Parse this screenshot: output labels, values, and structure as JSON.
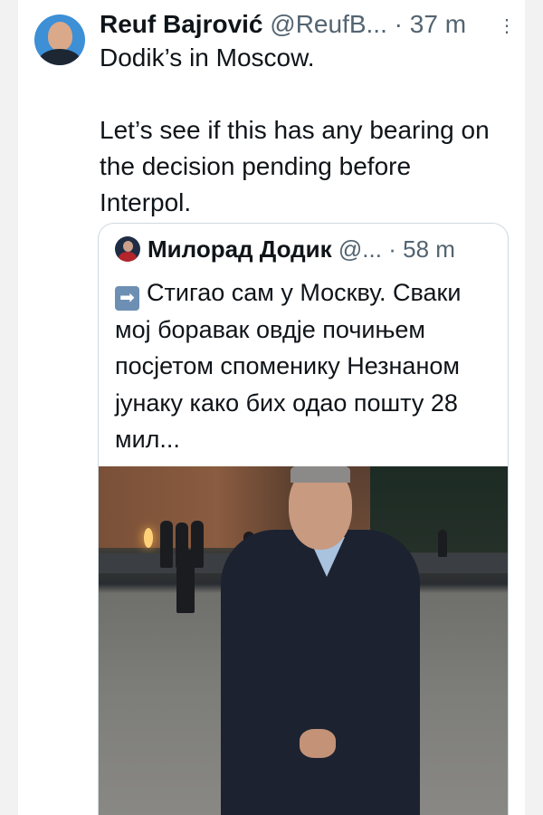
{
  "tweet": {
    "author_name": "Reuf Bajrović",
    "author_handle": "@ReufB...",
    "separator": "·",
    "time": "37 m",
    "more_icon": "⋮",
    "text": "Dodik’s in Moscow.\n\nLet’s see if this has any bearing on the decision pending before Interpol."
  },
  "quote": {
    "author_name": "Милорад Додик",
    "author_handle": "@...",
    "separator": "·",
    "time": "58 m",
    "emoji": "➡",
    "text": "Стигао сам у Москву. Сваки мој боравак овдје почињем посјетом споменику Незнаном јунаку како бих одао пошту 28 мил..."
  },
  "colors": {
    "text": "#0f1419",
    "secondary": "#536471",
    "border": "#cfd9de"
  },
  "icons": {
    "avatar": "avatar-icon",
    "more": "more-icon",
    "arrow": "right-arrow-icon"
  }
}
